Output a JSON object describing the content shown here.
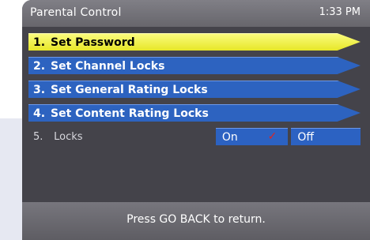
{
  "header": {
    "title": "Parental Control",
    "time": "1:33 PM"
  },
  "menu": {
    "items": [
      {
        "num": "1.",
        "label": "Set Password"
      },
      {
        "num": "2.",
        "label": "Set Channel Locks"
      },
      {
        "num": "3.",
        "label": "Set General Rating Locks"
      },
      {
        "num": "4.",
        "label": "Set Content Rating Locks"
      }
    ],
    "locks": {
      "num": "5.",
      "label": "Locks",
      "on_label": "On",
      "off_label": "Off",
      "selected": "On"
    }
  },
  "footer": {
    "hint": "Press GO BACK to return."
  },
  "colors": {
    "selected_item": "#f0f04a",
    "menu_item": "#2d63c0",
    "check_mark": "#e1231f"
  },
  "icons": {
    "check": "check-icon"
  }
}
